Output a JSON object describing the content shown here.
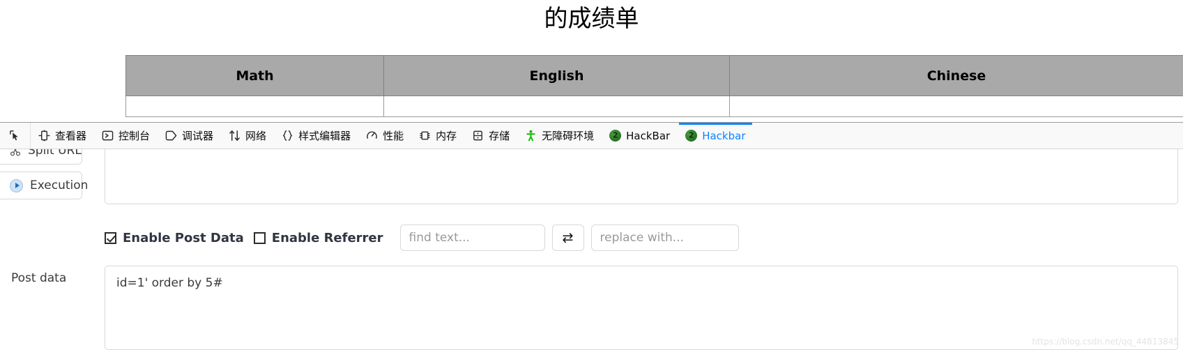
{
  "webpage": {
    "title": "的成绩单",
    "table": {
      "headers": [
        "Math",
        "English",
        "Chinese"
      ],
      "rows": [
        [
          "",
          "",
          ""
        ]
      ]
    }
  },
  "devtools": {
    "picker_icon": "element-picker-icon",
    "tabs": [
      {
        "label": "查看器",
        "icon": "inspector-icon",
        "active": false
      },
      {
        "label": "控制台",
        "icon": "console-icon",
        "active": false
      },
      {
        "label": "调试器",
        "icon": "debugger-icon",
        "active": false
      },
      {
        "label": "网络",
        "icon": "network-icon",
        "active": false
      },
      {
        "label": "样式编辑器",
        "icon": "style-editor-icon",
        "active": false
      },
      {
        "label": "性能",
        "icon": "performance-icon",
        "active": false
      },
      {
        "label": "内存",
        "icon": "memory-icon",
        "active": false
      },
      {
        "label": "存储",
        "icon": "storage-icon",
        "active": false
      },
      {
        "label": "无障碍环境",
        "icon": "accessibility-icon",
        "active": false
      },
      {
        "label": "HackBar",
        "icon": "hackbar-icon",
        "active": false
      },
      {
        "label": "Hackbar",
        "icon": "hackbar-icon",
        "active": true
      }
    ],
    "active_tab_color": "#0a84ff",
    "accessibility_icon_color": "#12bc00"
  },
  "hackbar": {
    "sidebar": [
      {
        "label": "Split URL",
        "icon": "scissors-icon"
      },
      {
        "label": "Execution",
        "icon": "play-circle-icon"
      }
    ],
    "url_value": "",
    "options": {
      "enable_post_data": {
        "label": "Enable Post Data",
        "checked": true
      },
      "enable_referrer": {
        "label": "Enable Referrer",
        "checked": false
      }
    },
    "find_placeholder": "find text...",
    "find_value": "",
    "replace_placeholder": "replace with...",
    "replace_value": "",
    "swap_icon": "⇄",
    "post_data": {
      "label": "Post data",
      "value": "id=1' order by 5#"
    }
  },
  "watermark": "https://blog.csdn.net/qq_44813845"
}
